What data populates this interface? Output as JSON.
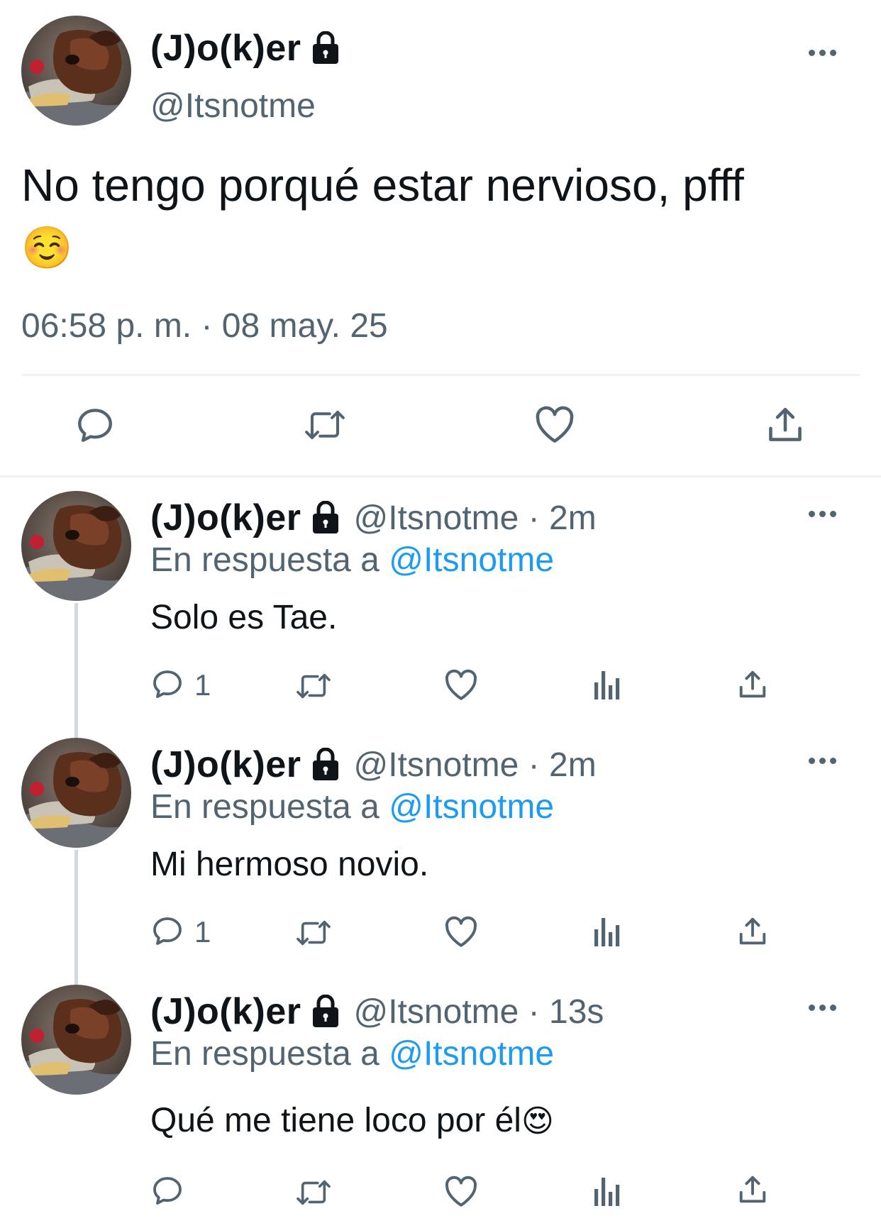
{
  "main_tweet": {
    "display_name": "(J)o(k)er",
    "handle": "@Itsnotme",
    "text": "No tengo porqué estar nervioso, pfff",
    "emoji": "☺️",
    "timestamp": "06:58 p. m. · 08 may. 25",
    "actions": [
      "reply-icon",
      "retweet-icon",
      "like-icon",
      "share-icon"
    ]
  },
  "replies": [
    {
      "display_name": "(J)o(k)er",
      "handle_time": "@Itsnotme · 2m",
      "reply_prefix": "En respuesta a",
      "reply_to": "@Itsnotme",
      "text": "Solo es Tae.",
      "reply_count": "1"
    },
    {
      "display_name": "(J)o(k)er",
      "handle_time": "@Itsnotme · 2m",
      "reply_prefix": "En respuesta a",
      "reply_to": "@Itsnotme",
      "text": "Mi hermoso novio.",
      "reply_count": "1"
    },
    {
      "display_name": "(J)o(k)er",
      "handle_time": "@Itsnotme · 13s",
      "reply_prefix": "En respuesta a",
      "reply_to": "@Itsnotme",
      "text": "Qué me tiene loco por él",
      "emoji": "😍",
      "reply_count": ""
    }
  ],
  "colors": {
    "text": "#0f1419",
    "muted": "#536471",
    "link": "#1d9bf0",
    "divider": "#eff3f4"
  }
}
